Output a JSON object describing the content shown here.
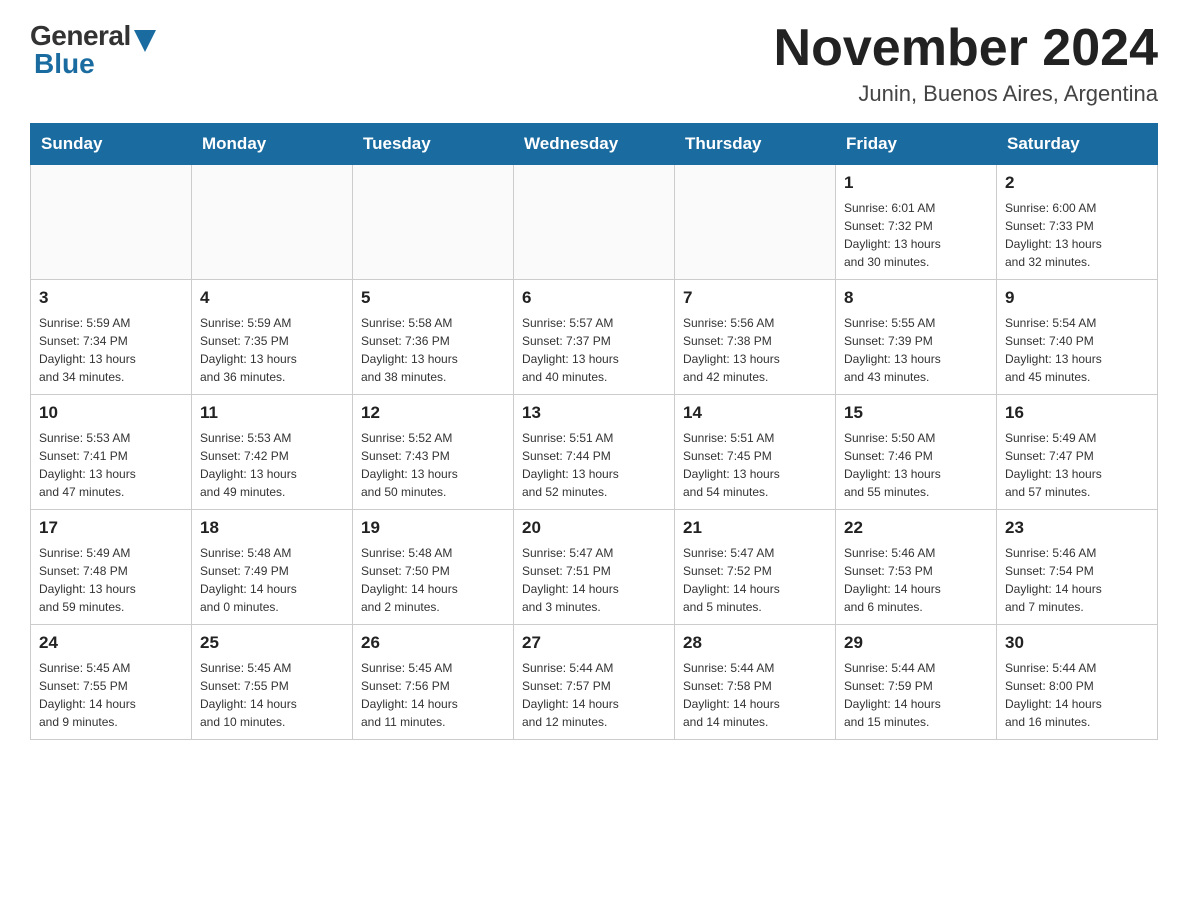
{
  "header": {
    "logo_general": "General",
    "logo_blue": "Blue",
    "title": "November 2024",
    "location": "Junin, Buenos Aires, Argentina"
  },
  "days_of_week": [
    "Sunday",
    "Monday",
    "Tuesday",
    "Wednesday",
    "Thursday",
    "Friday",
    "Saturday"
  ],
  "weeks": [
    [
      {
        "day": "",
        "info": ""
      },
      {
        "day": "",
        "info": ""
      },
      {
        "day": "",
        "info": ""
      },
      {
        "day": "",
        "info": ""
      },
      {
        "day": "",
        "info": ""
      },
      {
        "day": "1",
        "info": "Sunrise: 6:01 AM\nSunset: 7:32 PM\nDaylight: 13 hours\nand 30 minutes."
      },
      {
        "day": "2",
        "info": "Sunrise: 6:00 AM\nSunset: 7:33 PM\nDaylight: 13 hours\nand 32 minutes."
      }
    ],
    [
      {
        "day": "3",
        "info": "Sunrise: 5:59 AM\nSunset: 7:34 PM\nDaylight: 13 hours\nand 34 minutes."
      },
      {
        "day": "4",
        "info": "Sunrise: 5:59 AM\nSunset: 7:35 PM\nDaylight: 13 hours\nand 36 minutes."
      },
      {
        "day": "5",
        "info": "Sunrise: 5:58 AM\nSunset: 7:36 PM\nDaylight: 13 hours\nand 38 minutes."
      },
      {
        "day": "6",
        "info": "Sunrise: 5:57 AM\nSunset: 7:37 PM\nDaylight: 13 hours\nand 40 minutes."
      },
      {
        "day": "7",
        "info": "Sunrise: 5:56 AM\nSunset: 7:38 PM\nDaylight: 13 hours\nand 42 minutes."
      },
      {
        "day": "8",
        "info": "Sunrise: 5:55 AM\nSunset: 7:39 PM\nDaylight: 13 hours\nand 43 minutes."
      },
      {
        "day": "9",
        "info": "Sunrise: 5:54 AM\nSunset: 7:40 PM\nDaylight: 13 hours\nand 45 minutes."
      }
    ],
    [
      {
        "day": "10",
        "info": "Sunrise: 5:53 AM\nSunset: 7:41 PM\nDaylight: 13 hours\nand 47 minutes."
      },
      {
        "day": "11",
        "info": "Sunrise: 5:53 AM\nSunset: 7:42 PM\nDaylight: 13 hours\nand 49 minutes."
      },
      {
        "day": "12",
        "info": "Sunrise: 5:52 AM\nSunset: 7:43 PM\nDaylight: 13 hours\nand 50 minutes."
      },
      {
        "day": "13",
        "info": "Sunrise: 5:51 AM\nSunset: 7:44 PM\nDaylight: 13 hours\nand 52 minutes."
      },
      {
        "day": "14",
        "info": "Sunrise: 5:51 AM\nSunset: 7:45 PM\nDaylight: 13 hours\nand 54 minutes."
      },
      {
        "day": "15",
        "info": "Sunrise: 5:50 AM\nSunset: 7:46 PM\nDaylight: 13 hours\nand 55 minutes."
      },
      {
        "day": "16",
        "info": "Sunrise: 5:49 AM\nSunset: 7:47 PM\nDaylight: 13 hours\nand 57 minutes."
      }
    ],
    [
      {
        "day": "17",
        "info": "Sunrise: 5:49 AM\nSunset: 7:48 PM\nDaylight: 13 hours\nand 59 minutes."
      },
      {
        "day": "18",
        "info": "Sunrise: 5:48 AM\nSunset: 7:49 PM\nDaylight: 14 hours\nand 0 minutes."
      },
      {
        "day": "19",
        "info": "Sunrise: 5:48 AM\nSunset: 7:50 PM\nDaylight: 14 hours\nand 2 minutes."
      },
      {
        "day": "20",
        "info": "Sunrise: 5:47 AM\nSunset: 7:51 PM\nDaylight: 14 hours\nand 3 minutes."
      },
      {
        "day": "21",
        "info": "Sunrise: 5:47 AM\nSunset: 7:52 PM\nDaylight: 14 hours\nand 5 minutes."
      },
      {
        "day": "22",
        "info": "Sunrise: 5:46 AM\nSunset: 7:53 PM\nDaylight: 14 hours\nand 6 minutes."
      },
      {
        "day": "23",
        "info": "Sunrise: 5:46 AM\nSunset: 7:54 PM\nDaylight: 14 hours\nand 7 minutes."
      }
    ],
    [
      {
        "day": "24",
        "info": "Sunrise: 5:45 AM\nSunset: 7:55 PM\nDaylight: 14 hours\nand 9 minutes."
      },
      {
        "day": "25",
        "info": "Sunrise: 5:45 AM\nSunset: 7:55 PM\nDaylight: 14 hours\nand 10 minutes."
      },
      {
        "day": "26",
        "info": "Sunrise: 5:45 AM\nSunset: 7:56 PM\nDaylight: 14 hours\nand 11 minutes."
      },
      {
        "day": "27",
        "info": "Sunrise: 5:44 AM\nSunset: 7:57 PM\nDaylight: 14 hours\nand 12 minutes."
      },
      {
        "day": "28",
        "info": "Sunrise: 5:44 AM\nSunset: 7:58 PM\nDaylight: 14 hours\nand 14 minutes."
      },
      {
        "day": "29",
        "info": "Sunrise: 5:44 AM\nSunset: 7:59 PM\nDaylight: 14 hours\nand 15 minutes."
      },
      {
        "day": "30",
        "info": "Sunrise: 5:44 AM\nSunset: 8:00 PM\nDaylight: 14 hours\nand 16 minutes."
      }
    ]
  ]
}
